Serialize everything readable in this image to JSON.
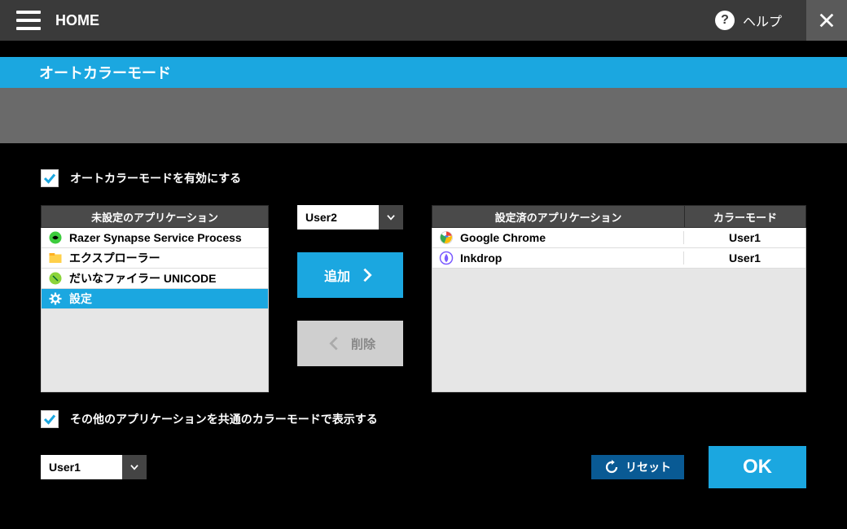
{
  "header": {
    "home": "HOME",
    "help": "ヘルプ"
  },
  "title": "オートカラーモード",
  "enable_checkbox": {
    "checked": true,
    "label": "オートカラーモードを有効にする"
  },
  "unset": {
    "header": "未設定のアプリケーション",
    "items": [
      {
        "name": "Razer Synapse Service Process",
        "icon": "razer",
        "selected": false
      },
      {
        "name": "エクスプローラー",
        "icon": "explorer",
        "selected": false
      },
      {
        "name": "だいなファイラー UNICODE",
        "icon": "dyna",
        "selected": false
      },
      {
        "name": "設定",
        "icon": "gear",
        "selected": true
      }
    ]
  },
  "mode_dropdown": {
    "value": "User2"
  },
  "add_button": "追加",
  "remove_button": "削除",
  "set": {
    "header_app": "設定済のアプリケーション",
    "header_mode": "カラーモード",
    "items": [
      {
        "name": "Google Chrome",
        "icon": "chrome",
        "mode": "User1"
      },
      {
        "name": "Inkdrop",
        "icon": "inkdrop",
        "mode": "User1"
      }
    ]
  },
  "other_checkbox": {
    "checked": true,
    "label": "その他のアプリケーションを共通のカラーモードで表示する"
  },
  "common_dropdown": {
    "value": "User1"
  },
  "reset_button": "リセット",
  "ok_button": "OK"
}
